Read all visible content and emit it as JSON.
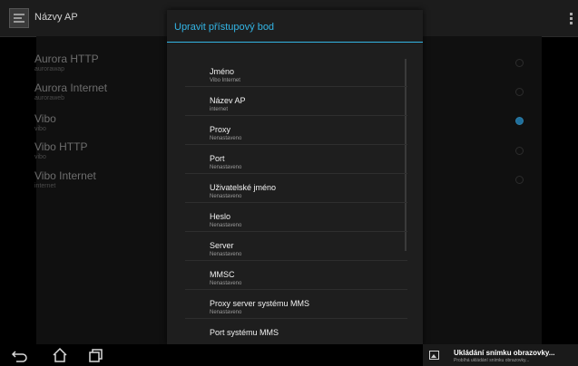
{
  "actionbar": {
    "title": "Názvy AP"
  },
  "apn_list": [
    {
      "name": "Aurora HTTP",
      "apn": "aurorawap",
      "selected": false
    },
    {
      "name": "Aurora Internet",
      "apn": "auroraweb",
      "selected": false
    },
    {
      "name": "Vibo",
      "apn": "vibo",
      "selected": true
    },
    {
      "name": "Vibo HTTP",
      "apn": "vibo",
      "selected": false
    },
    {
      "name": "Vibo Internet",
      "apn": "internet",
      "selected": false
    }
  ],
  "dialog": {
    "title": "Upravit přístupový bod",
    "accent_color": "#33b5e5",
    "items": [
      {
        "title": "Jméno",
        "summary": "Vibo Internet"
      },
      {
        "title": "Název AP",
        "summary": "internet"
      },
      {
        "title": "Proxy",
        "summary": "Nenastaveno"
      },
      {
        "title": "Port",
        "summary": "Nenastaveno"
      },
      {
        "title": "Uživatelské jméno",
        "summary": "Nenastaveno"
      },
      {
        "title": "Heslo",
        "summary": "Nenastaveno"
      },
      {
        "title": "Server",
        "summary": "Nenastaveno"
      },
      {
        "title": "MMSC",
        "summary": "Nenastaveno"
      },
      {
        "title": "Proxy server systému MMS",
        "summary": "Nenastaveno"
      },
      {
        "title": "Port systému MMS",
        "summary": ""
      }
    ]
  },
  "notification": {
    "title": "Ukládání snímku obrazovky...",
    "subtitle": "Probíhá ukládání snímku obrazovky..."
  },
  "icons": [
    "app-settings-icon",
    "overflow-menu-icon",
    "back-icon",
    "home-icon",
    "recent-apps-icon",
    "image-icon"
  ]
}
